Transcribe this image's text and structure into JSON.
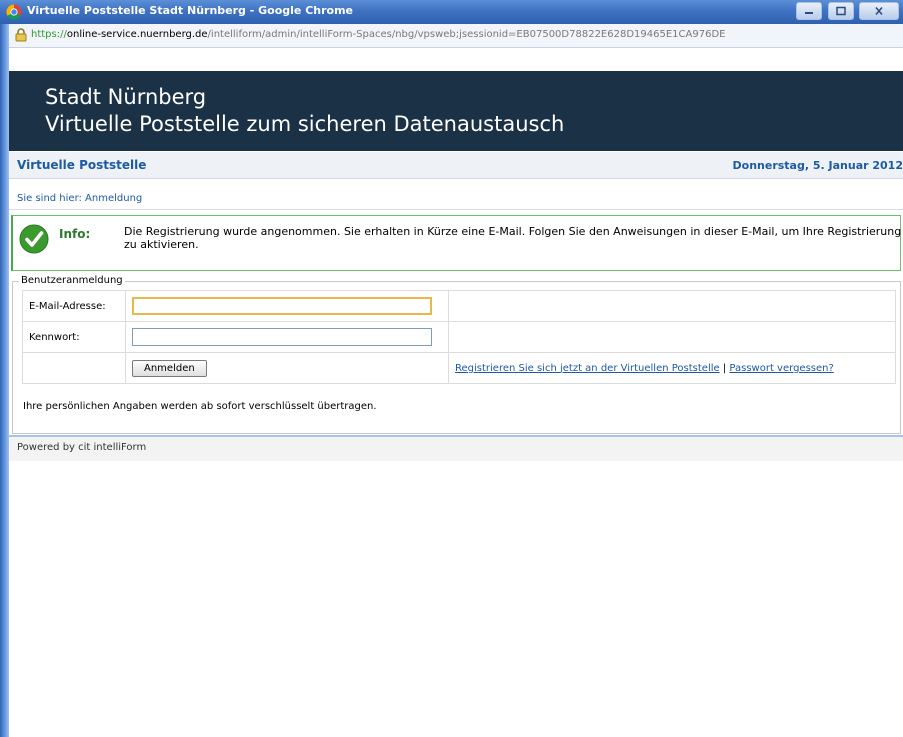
{
  "window": {
    "title": "Virtuelle Poststelle Stadt Nürnberg - Google Chrome"
  },
  "address_bar": {
    "scheme": "https://",
    "host": "online-service.nuernberg.de",
    "path": "/intelliform/admin/intelliForm-Spaces/nbg/vpsweb;jsessionid=EB07500D78822E628D19465E1CA976DE"
  },
  "banner": {
    "city": "Stadt Nürnberg",
    "subtitle": "Virtuelle Poststelle zum sicheren Datenaustausch"
  },
  "nav": {
    "title": "Virtuelle Poststelle",
    "date": "Donnerstag, 5. Januar 2012"
  },
  "breadcrumb": "Sie sind hier: Anmeldung",
  "info": {
    "label": "Info:",
    "message": "Die Registrierung wurde angenommen. Sie erhalten in Kürze eine E-Mail. Folgen Sie den Anweisungen in dieser E-Mail, um Ihre Registrierung zu aktivieren."
  },
  "login": {
    "legend": "Benutzeranmeldung",
    "email_label": "E-Mail-Adresse:",
    "password_label": "Kennwort:",
    "email_value": "",
    "password_value": "",
    "submit_label": "Anmelden",
    "register_link": "Registrieren Sie sich jetzt an der Virtuellen Poststelle",
    "separator": "|",
    "forgot_link": "Passwort vergessen?",
    "note": "Ihre persönlichen Angaben werden ab sofort verschlüsselt übertragen."
  },
  "footer": "Powered by cit intelliForm",
  "colors": {
    "banner_bg": "#1b3146",
    "link": "#1d5aa2",
    "info_border": "#6abf69"
  }
}
